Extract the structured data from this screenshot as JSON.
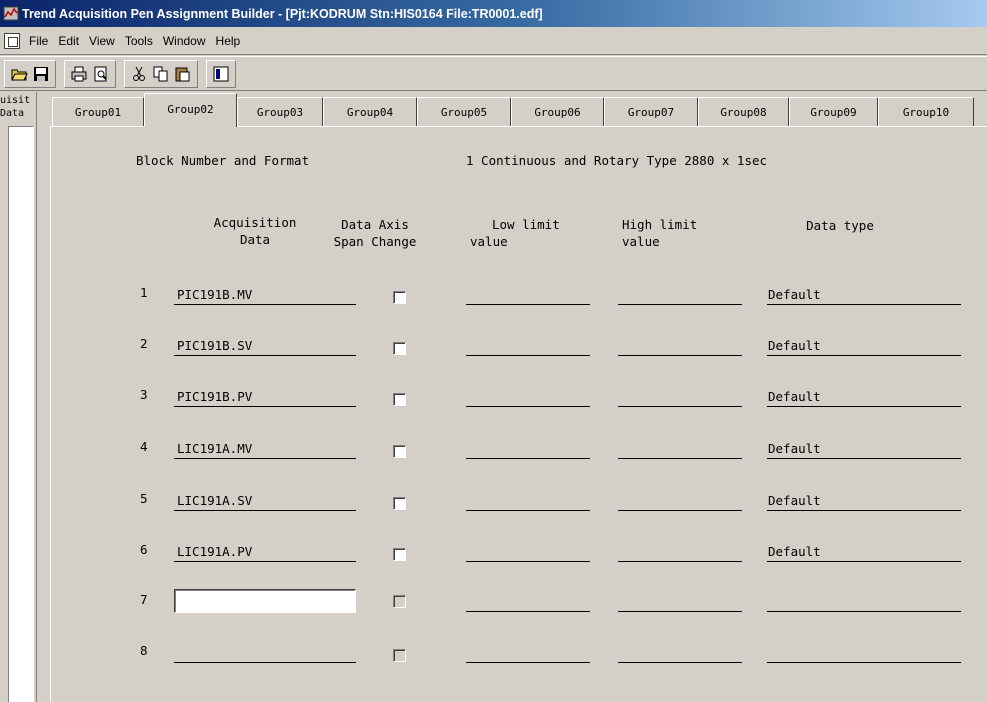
{
  "window": {
    "title": "Trend Acquisition Pen Assignment Builder - [Pjt:KODRUM Stn:HIS0164 File:TR0001.edf]"
  },
  "menu": {
    "items": [
      "File",
      "Edit",
      "View",
      "Tools",
      "Window",
      "Help"
    ]
  },
  "toolbar": {
    "buttons": [
      "open-folder-icon",
      "save-icon",
      "print-icon",
      "print-preview-icon",
      "cut-icon",
      "copy-icon",
      "paste-icon",
      "properties-icon"
    ]
  },
  "leftpane": {
    "label": "uisit\nData"
  },
  "tabs": {
    "items": [
      "Group01",
      "Group02",
      "Group03",
      "Group04",
      "Group05",
      "Group06",
      "Group07",
      "Group08",
      "Group09",
      "Group10"
    ],
    "active": "Group02"
  },
  "form": {
    "block_label": "Block Number and Format",
    "block_value": "1 Continuous and Rotary Type 2880 x 1sec",
    "headers": {
      "acquisition_data": "Acquisition\nData",
      "data_axis": "Data Axis\nSpan Change",
      "low_limit": "Low limit\nvalue",
      "high_limit": "High limit\nvalue",
      "data_type": "Data type"
    },
    "rows": [
      {
        "num": "1",
        "acq": "PIC191B.MV",
        "low": "",
        "high": "",
        "type": "Default"
      },
      {
        "num": "2",
        "acq": "PIC191B.SV",
        "low": "",
        "high": "",
        "type": "Default"
      },
      {
        "num": "3",
        "acq": "PIC191B.PV",
        "low": "",
        "high": "",
        "type": "Default"
      },
      {
        "num": "4",
        "acq": "LIC191A.MV",
        "low": "",
        "high": "",
        "type": "Default"
      },
      {
        "num": "5",
        "acq": "LIC191A.SV",
        "low": "",
        "high": "",
        "type": "Default"
      },
      {
        "num": "6",
        "acq": "LIC191A.PV",
        "low": "",
        "high": "",
        "type": "Default"
      },
      {
        "num": "7",
        "acq": "",
        "low": "",
        "high": "",
        "type": ""
      },
      {
        "num": "8",
        "acq": "",
        "low": "",
        "high": "",
        "type": ""
      }
    ]
  },
  "colors": {
    "face": "#d4d0c8",
    "titlebar_start": "#0a246a",
    "titlebar_end": "#a6caf0"
  }
}
